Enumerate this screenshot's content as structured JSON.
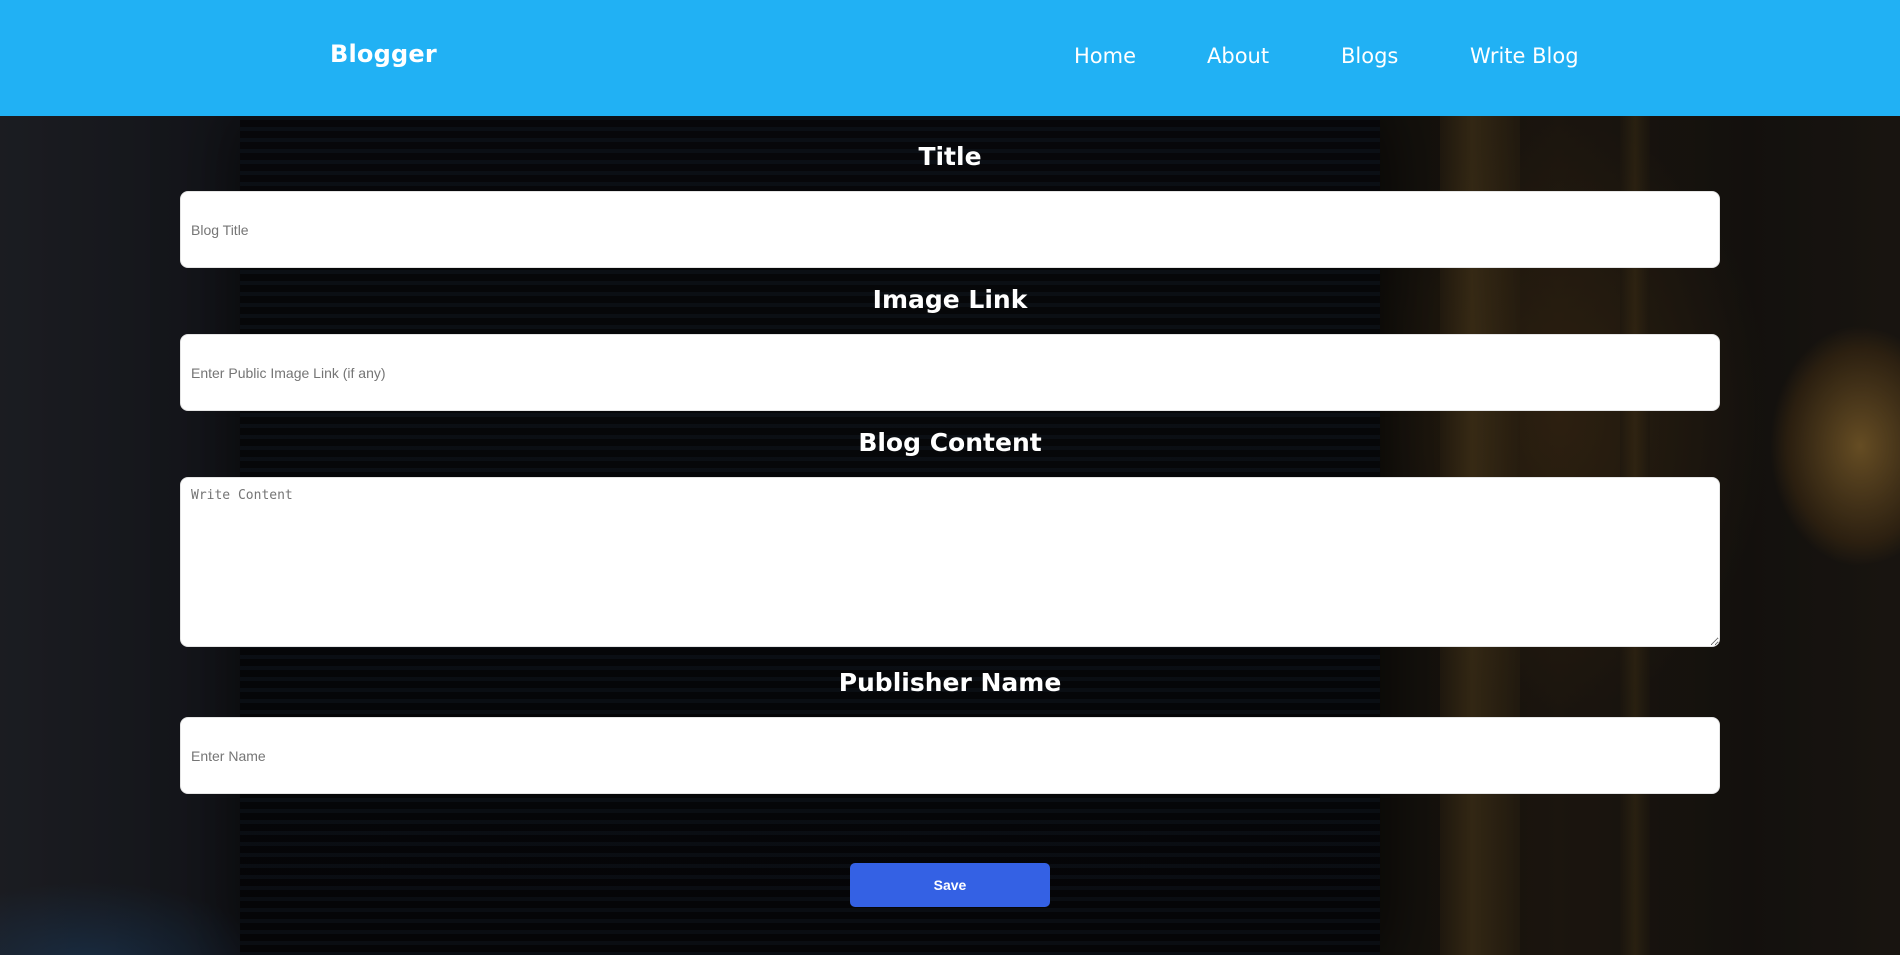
{
  "header": {
    "brand": "Blogger",
    "nav": [
      {
        "label": "Home"
      },
      {
        "label": "About"
      },
      {
        "label": "Blogs"
      },
      {
        "label": "Write Blog"
      }
    ],
    "color": "#21b1f4"
  },
  "form": {
    "title": {
      "label": "Title",
      "placeholder": "Blog Title",
      "value": ""
    },
    "image": {
      "label": "Image Link",
      "placeholder": "Enter Public Image Link (if any)",
      "value": ""
    },
    "content": {
      "label": "Blog Content",
      "placeholder": "Write Content",
      "value": ""
    },
    "publisher": {
      "label": "Publisher Name",
      "placeholder": "Enter Name",
      "value": ""
    },
    "save_label": "Save"
  },
  "colors": {
    "button": "#3461e4"
  }
}
